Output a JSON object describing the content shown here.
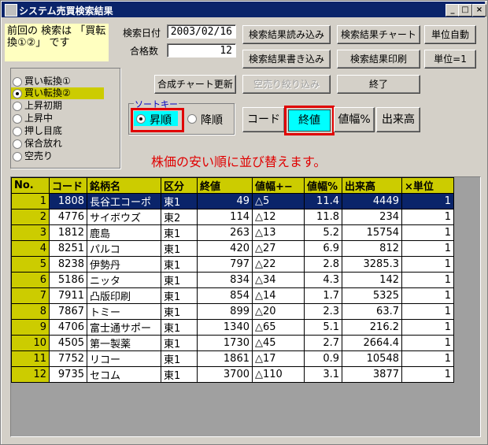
{
  "window": {
    "title": "システム売買検索結果",
    "minimize": "_",
    "maximize": "□",
    "close": "×"
  },
  "note": "前回の 検索は 「買転換①②」 です",
  "search_date_label": "検索日付",
  "search_date_value": "2003/02/16",
  "pass_count_label": "合格数",
  "pass_count_value": "12",
  "buttons": {
    "load_results": "検索結果読み込み",
    "write_results": "検索結果書き込み",
    "result_chart": "検索結果チャート",
    "print_results": "検索結果印刷",
    "auto_unit": "単位自動",
    "unit_one": "単位=1",
    "update_chart": "合成チャート更新",
    "short_filter": "空売り絞り込み",
    "exit": "終了"
  },
  "radio_options": [
    {
      "label": "買い転換①",
      "selected": false
    },
    {
      "label": "買い転換②",
      "selected": true
    },
    {
      "label": "上昇初期",
      "selected": false
    },
    {
      "label": "上昇中",
      "selected": false
    },
    {
      "label": "押し目底",
      "selected": false
    },
    {
      "label": "保合放れ",
      "selected": false
    },
    {
      "label": "空売り",
      "selected": false
    }
  ],
  "sort": {
    "caption": "ソートキー",
    "ascending": "昇順",
    "descending": "降順",
    "keys": {
      "code": "コード",
      "close": "終値",
      "range_pct": "値幅%",
      "volume": "出来高"
    }
  },
  "message": "株価の安い順に並び替えます。",
  "table": {
    "columns": [
      "No.",
      "コード",
      "銘柄名",
      "区分",
      "終値",
      "値幅+−",
      "値幅%",
      "出来高",
      "×単位"
    ],
    "rows": [
      [
        "1",
        "1808",
        "長谷工コーポ",
        "東1",
        "49",
        "△5",
        "11.4",
        "4449",
        "1"
      ],
      [
        "2",
        "4776",
        "サイボウズ",
        "東2",
        "114",
        "△12",
        "11.8",
        "234",
        "1"
      ],
      [
        "3",
        "1812",
        "鹿島",
        "東1",
        "263",
        "△13",
        "5.2",
        "15754",
        "1"
      ],
      [
        "4",
        "8251",
        "パルコ",
        "東1",
        "420",
        "△27",
        "6.9",
        "812",
        "1"
      ],
      [
        "5",
        "8238",
        "伊勢丹",
        "東1",
        "797",
        "△22",
        "2.8",
        "3285.3",
        "1"
      ],
      [
        "6",
        "5186",
        "ニッタ",
        "東1",
        "834",
        "△34",
        "4.3",
        "142",
        "1"
      ],
      [
        "7",
        "7911",
        "凸版印刷",
        "東1",
        "854",
        "△14",
        "1.7",
        "5325",
        "1"
      ],
      [
        "8",
        "7867",
        "トミー",
        "東1",
        "899",
        "△20",
        "2.3",
        "63.7",
        "1"
      ],
      [
        "9",
        "4706",
        "富士通サポー",
        "東1",
        "1340",
        "△65",
        "5.1",
        "216.2",
        "1"
      ],
      [
        "10",
        "4505",
        "第一製薬",
        "東1",
        "1730",
        "△45",
        "2.7",
        "2664.4",
        "1"
      ],
      [
        "11",
        "7752",
        "リコー",
        "東1",
        "1861",
        "△17",
        "0.9",
        "10548",
        "1"
      ],
      [
        "12",
        "9735",
        "セコム",
        "東1",
        "3700",
        "△110",
        "3.1",
        "3877",
        "1"
      ]
    ],
    "selected_row": 0
  }
}
